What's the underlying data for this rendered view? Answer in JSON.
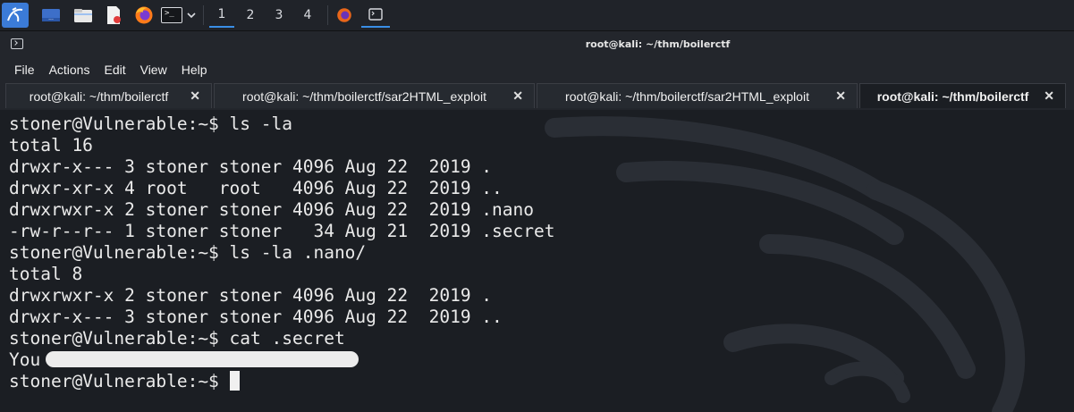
{
  "taskbar": {
    "workspaces": [
      "1",
      "2",
      "3",
      "4"
    ],
    "active_workspace": "1",
    "terminal_glyph": ">_",
    "icons": [
      "kali-menu-icon",
      "desktop-icon",
      "file-manager-icon",
      "text-editor-icon",
      "firefox-icon",
      "terminal-icon",
      "chevron-down-icon",
      "firefox-running-icon",
      "terminal-running-icon"
    ]
  },
  "window": {
    "title": "root@kali: ~/thm/boilerctf"
  },
  "menu": [
    "File",
    "Actions",
    "Edit",
    "View",
    "Help"
  ],
  "tabs": [
    {
      "label": "root@kali: ~/thm/boilerctf",
      "close": "✕",
      "active": false
    },
    {
      "label": "root@kali: ~/thm/boilerctf/sar2HTML_exploit",
      "close": "✕",
      "active": false
    },
    {
      "label": "root@kali: ~/thm/boilerctf/sar2HTML_exploit",
      "close": "✕",
      "active": false
    },
    {
      "label": "root@kali: ~/thm/boilerctf",
      "close": "✕",
      "active": true
    }
  ],
  "terminal": {
    "lines": [
      "stoner@Vulnerable:~$ ls -la",
      "total 16",
      "drwxr-x--- 3 stoner stoner 4096 Aug 22  2019 .",
      "drwxr-xr-x 4 root   root   4096 Aug 22  2019 ..",
      "drwxrwxr-x 2 stoner stoner 4096 Aug 22  2019 .nano",
      "-rw-r--r-- 1 stoner stoner   34 Aug 21  2019 .secret",
      "stoner@Vulnerable:~$ ls -la .nano/",
      "total 8",
      "drwxrwxr-x 2 stoner stoner 4096 Aug 22  2019 .",
      "drwxr-x--- 3 stoner stoner 4096 Aug 22  2019 ..",
      "stoner@Vulnerable:~$ cat .secret",
      "You",
      "stoner@Vulnerable:~$ "
    ],
    "redacted_line_index": 11,
    "cursor_line_index": 12
  }
}
